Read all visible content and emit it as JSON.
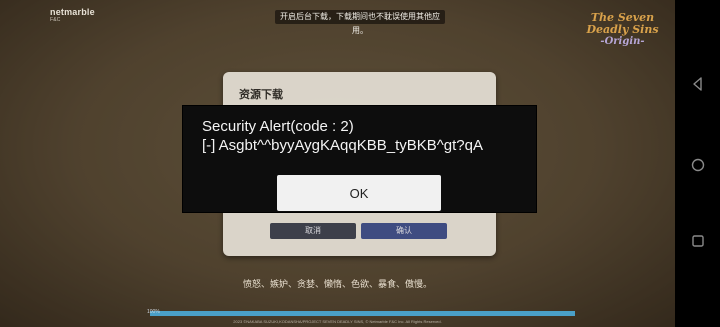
{
  "top_notice": "开启后台下载，下载期间也不耽误使用其他应用。",
  "brand": {
    "name": "netmarble",
    "sub": "F&C"
  },
  "logo": {
    "line1": "The Seven",
    "line2": "Deadly Sins",
    "line3": "-Origin-"
  },
  "resource_dialog": {
    "title": "资源下载",
    "cancel_label": "取消",
    "confirm_label": "确认"
  },
  "security_alert": {
    "line1": "Security Alert(code : 2)",
    "line2": "[-] Asgbt^^byyAygKAqqKBB_tyBKB^gt?qA",
    "ok_label": "OK"
  },
  "flavor_text": "愤怒、嫉妒、贪婪、懒惰、色欲、暴食、傲慢。",
  "progress": {
    "label": "100%",
    "value": 1.0
  },
  "copyright": "2023 ©NAKABA SUZUKI,KODANSHA/PROJECT SEVEN DEADLY SINS, © Netmarble F&C Inc. All Rights Reserved.",
  "nav": {
    "back_icon": "back-triangle-icon",
    "home_icon": "home-circle-icon",
    "recent_icon": "recent-square-icon"
  }
}
